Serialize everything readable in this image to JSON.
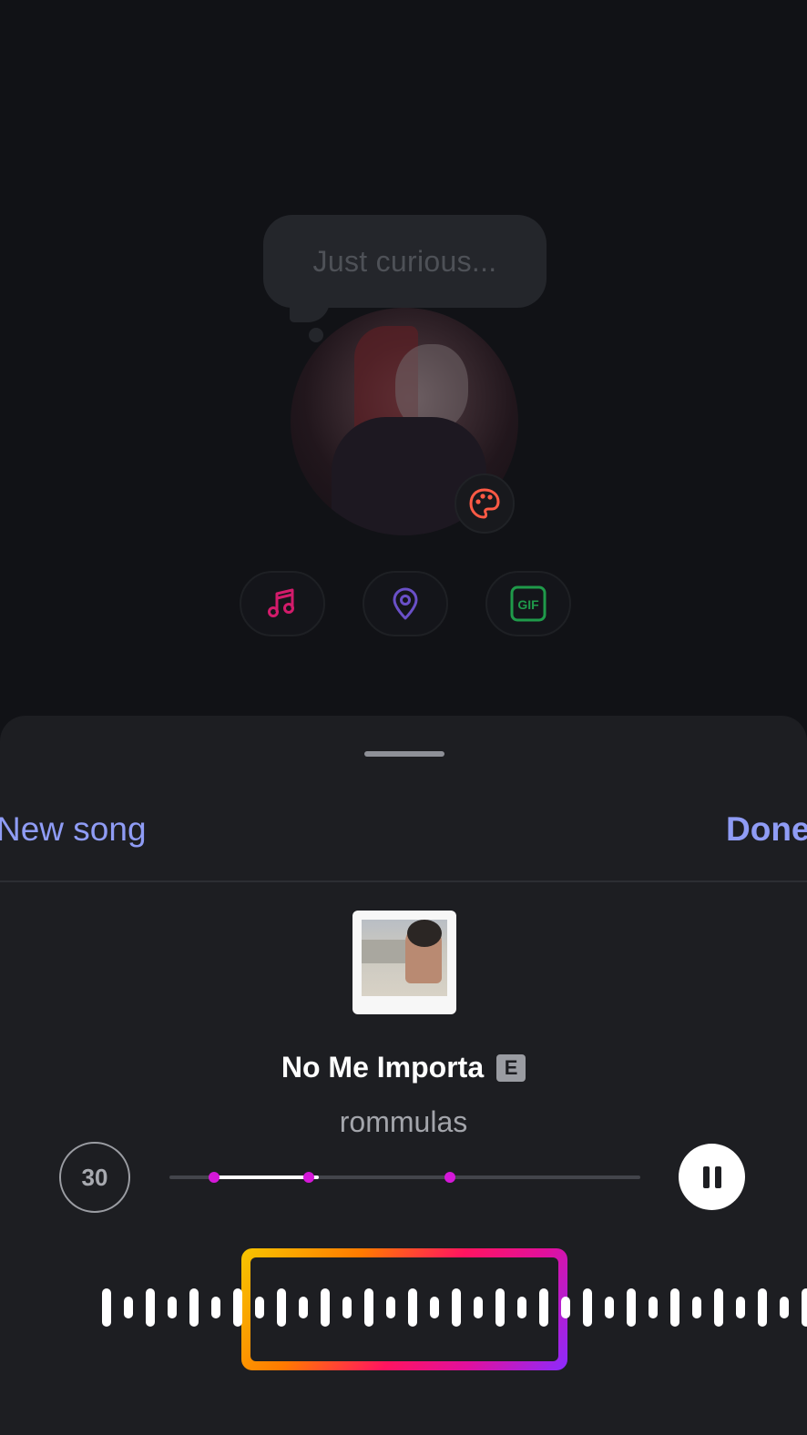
{
  "background_scene": {
    "prompt_text": "Just curious...",
    "icons": {
      "palette": "palette-icon",
      "music": "music-note-icon",
      "location": "location-pin-icon",
      "gif": "gif-icon"
    },
    "gif_label": "GIF"
  },
  "sheet": {
    "new_song_label": "New song",
    "done_label": "Done",
    "track": {
      "title": "No Me Importa",
      "explicit_badge": "E",
      "artist": "rommulas"
    },
    "clip_duration": "30",
    "playback": {
      "progress_start_fraction": 0.095,
      "progress_end_fraction": 0.317,
      "marker_fractions": [
        0.095,
        0.295,
        0.595
      ],
      "state": "playing",
      "pause_icon": "pause-icon"
    }
  },
  "colors": {
    "accent": "#8f9cf5",
    "marker": "#d418d8",
    "music_icon": "#d31b6b",
    "location_icon": "#6a50c8",
    "gif_icon": "#1f9a4a",
    "palette_icon": "#ff5a45"
  }
}
